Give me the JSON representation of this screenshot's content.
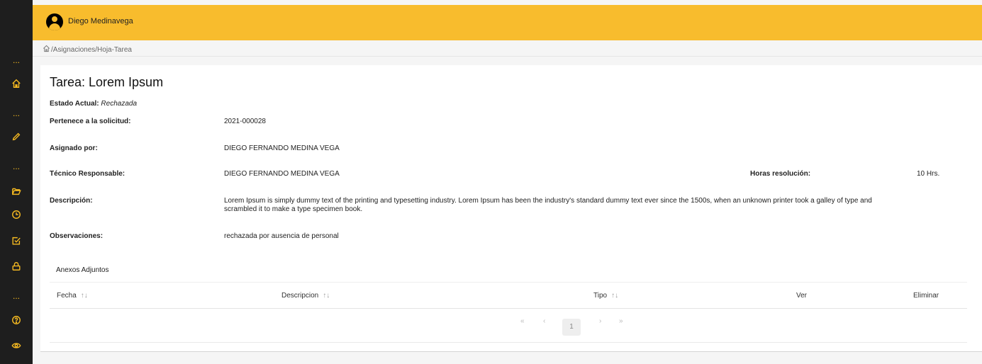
{
  "accent_color": "#f8bc2d",
  "sidebar_bg": "#1e1e1e",
  "header": {
    "username": "Diego Medinavega",
    "avatar_icon": "user-circle-icon"
  },
  "breadcrumb": {
    "home_icon": "home-icon",
    "path": "/Asignaciones/Hoja-Tarea"
  },
  "sidebar": {
    "icons": [
      "home-icon",
      "pencil-icon",
      "folder-icon",
      "clock-icon",
      "check-square-icon",
      "lock-icon",
      "help-circle-icon",
      "eye-icon"
    ],
    "dots": "..."
  },
  "task": {
    "title": "Tarea: Lorem Ipsum",
    "estado_label": "Estado Actual:",
    "estado_value": "Rechazada",
    "solicitud_label": "Pertenece a la solicitud:",
    "solicitud_value": "2021-000028",
    "asignado_label": "Asignado por:",
    "asignado_value": "DIEGO FERNANDO MEDINA VEGA",
    "tecnico_label": "Técnico Responsable:",
    "tecnico_value": "DIEGO FERNANDO MEDINA VEGA",
    "horas_label": "Horas resolución:",
    "horas_value": "10 Hrs.",
    "descripcion_label": "Descripción:",
    "descripcion_value": "Lorem Ipsum is simply dummy text of the printing and typesetting industry. Lorem Ipsum has been the industry's standard dummy text ever since the 1500s, when an unknown printer took a galley of type and scrambled it to make a type specimen book.",
    "observaciones_label": "Observaciones:",
    "observaciones_value": "rechazada por ausencia de personal"
  },
  "anexos": {
    "title": "Anexos Adjuntos",
    "columns": [
      "Fecha",
      "Descripcion",
      "Tipo",
      "Ver",
      "Eliminar"
    ],
    "sort_icon": "↑↓",
    "pagination": {
      "first": "«",
      "prev": "‹",
      "current": "1",
      "next": "›",
      "last": "»"
    }
  }
}
